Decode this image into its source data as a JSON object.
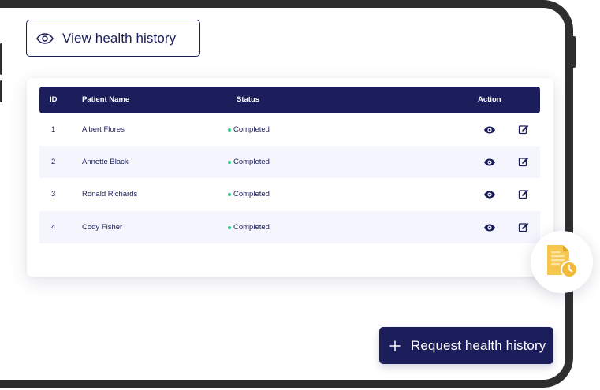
{
  "view_button": {
    "label": "View health history",
    "icon": "eye-icon"
  },
  "table": {
    "headers": {
      "id": "ID",
      "name": "Patient Name",
      "status": "Status",
      "action": "Action"
    },
    "rows": [
      {
        "id": "1",
        "name": "Albert Flores",
        "status": "Completed"
      },
      {
        "id": "2",
        "name": "Annette Black",
        "status": "Completed"
      },
      {
        "id": "3",
        "name": "Ronald Richards",
        "status": "Completed"
      },
      {
        "id": "4",
        "name": "Cody Fisher",
        "status": "Completed"
      }
    ],
    "row_actions": [
      "eye-icon",
      "edit-icon"
    ]
  },
  "request_button": {
    "label": "Request health history",
    "icon": "plus-icon"
  },
  "badge": {
    "icon": "document-clock-icon"
  },
  "colors": {
    "primary": "#1b1e5a",
    "status_dot": "#2ecf8a",
    "row_alt": "#f4f5fd",
    "document": "#f7c64f",
    "device_frame": "#2e2e2e"
  }
}
